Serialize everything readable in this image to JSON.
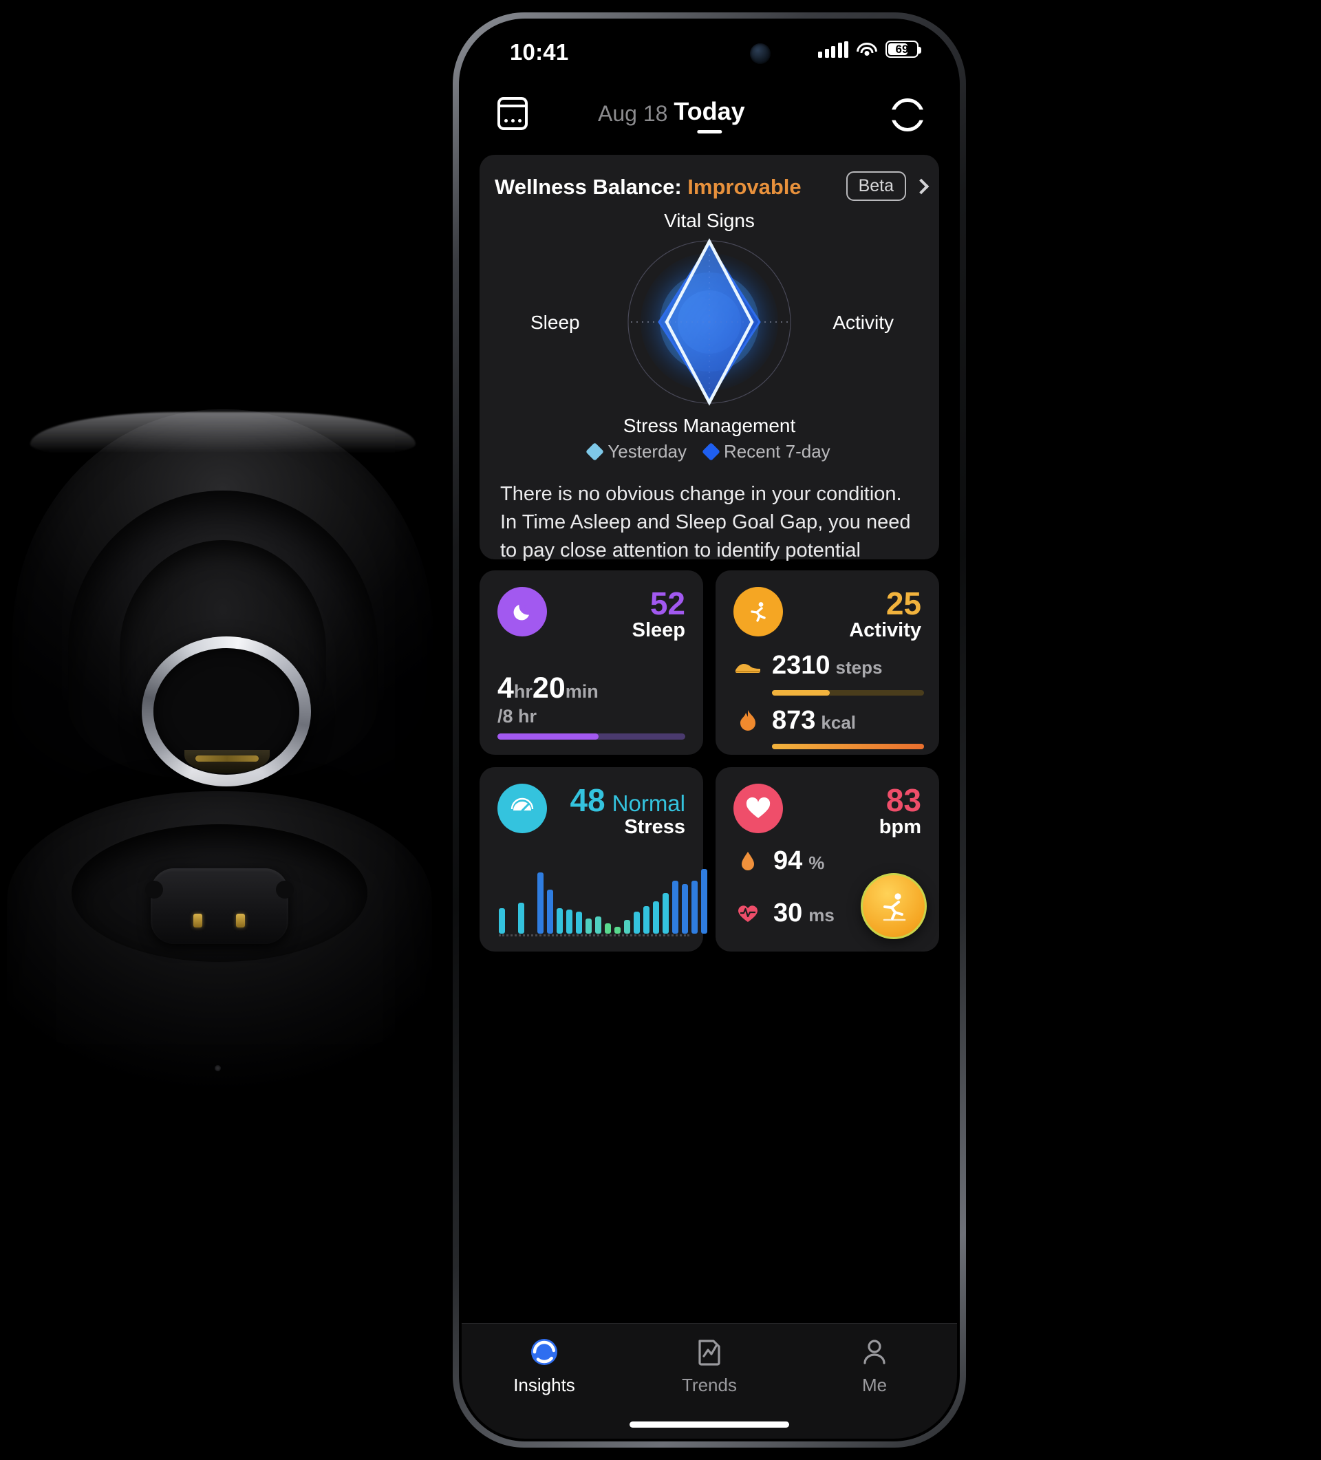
{
  "product": {
    "name": "smart-ring-charging-case"
  },
  "status_bar": {
    "time": "10:41",
    "battery_percent": "69",
    "signal_icon": "cellular-signal-icon",
    "wifi_icon": "wifi-icon",
    "battery_icon": "battery-icon"
  },
  "nav": {
    "calendar_icon": "calendar-icon",
    "date": "Aug 18",
    "today": "Today",
    "refresh_icon": "sync-icon"
  },
  "wellness": {
    "title_prefix": "Wellness Balance: ",
    "title_status": "Improvable",
    "status_color": "#e8913c",
    "beta_label": "Beta",
    "chevron_right_icon": "chevron-right-icon",
    "axes": {
      "top": "Vital Signs",
      "left": "Sleep",
      "right": "Activity",
      "bottom": "Stress Management"
    },
    "legend": [
      {
        "label": "Yesterday",
        "color": "#7ec8e8"
      },
      {
        "label": "Recent 7-day",
        "color": "#1f5ff0"
      }
    ],
    "description": "There is no obvious change in your condition. In Time Asleep and Sleep Goal Gap, you need to pay close attention to identify potential problems and take...",
    "expand_icon": "chevron-down-icon"
  },
  "chart_data": {
    "type": "radar",
    "title": "Wellness Balance",
    "categories": [
      "Vital Signs",
      "Activity",
      "Stress Management",
      "Sleep"
    ],
    "series": [
      {
        "name": "Yesterday",
        "values": [
          95,
          52,
          96,
          50
        ],
        "color": "#7ec8e8"
      },
      {
        "name": "Recent 7-day",
        "values": [
          82,
          62,
          86,
          44
        ],
        "color": "#1f5ff0"
      }
    ],
    "range": [
      0,
      100
    ],
    "grid": true,
    "legend_position": "bottom"
  },
  "metrics": {
    "sleep": {
      "icon": "sleep-moon-icon",
      "icon_color": "#a259f0",
      "score": "52",
      "score_color": "#a259f0",
      "label": "Sleep",
      "hours": "4",
      "hours_unit": "hr",
      "minutes": "20",
      "minutes_unit": "min",
      "goal": "/8 hr",
      "progress_percent": 54
    },
    "activity": {
      "icon": "running-person-icon",
      "icon_color": "#f5a623",
      "score": "25",
      "score_color": "#f2b33d",
      "label": "Activity",
      "steps_icon": "shoe-icon",
      "steps_value": "2310",
      "steps_unit": "steps",
      "steps_progress_percent": 38,
      "kcal_icon": "flame-icon",
      "kcal_value": "873",
      "kcal_unit": "kcal",
      "kcal_progress_percent": 100
    },
    "stress": {
      "icon": "gauge-icon",
      "icon_color": "#34c3de",
      "score": "48",
      "score_word": "Normal",
      "score_color": "#34c3de",
      "label": "Stress",
      "chart": {
        "type": "bar",
        "values": [
          30,
          0,
          36,
          0,
          72,
          52,
          30,
          28,
          26,
          18,
          20,
          12,
          8,
          16,
          26,
          32,
          38,
          48,
          62,
          58,
          62,
          76
        ],
        "colors": [
          "#34c3de",
          "#34c3de",
          "#34c3de",
          "#34c3de",
          "#2f7de0",
          "#2f7de0",
          "#34c3de",
          "#34c3de",
          "#34c3de",
          "#4fd0c0",
          "#4fd0c0",
          "#59d98e",
          "#59d98e",
          "#4fd0c0",
          "#34c3de",
          "#34c3de",
          "#34c3de",
          "#34c3de",
          "#2f7de0",
          "#2f7de0",
          "#2f7de0",
          "#2f7de0"
        ]
      }
    },
    "heart": {
      "icon": "heart-icon",
      "icon_color": "#ef4e6a",
      "value": "83",
      "value_color": "#ef4e6a",
      "unit": "bpm",
      "spo2_icon": "blood-drop-icon",
      "spo2_value": "94",
      "spo2_unit": "%",
      "hrv_icon": "heartbeat-icon",
      "hrv_value": "30",
      "hrv_unit": "ms",
      "fab_icon": "workout-running-icon"
    }
  },
  "tabs": [
    {
      "label": "Insights",
      "icon": "insights-ring-icon",
      "active": true
    },
    {
      "label": "Trends",
      "icon": "trends-chart-icon",
      "active": false
    },
    {
      "label": "Me",
      "icon": "person-icon",
      "active": false
    }
  ]
}
